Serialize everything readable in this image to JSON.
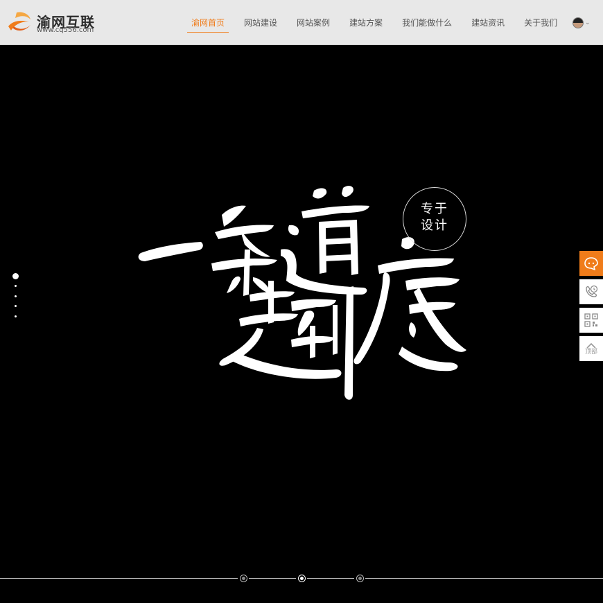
{
  "brand": {
    "title": "渝网互联",
    "url": "www.cq556.com"
  },
  "nav": {
    "items": [
      {
        "label": "渝网首页",
        "active": true
      },
      {
        "label": "网站建设",
        "active": false
      },
      {
        "label": "网站案例",
        "active": false
      },
      {
        "label": "建站方案",
        "active": false
      },
      {
        "label": "我们能做什么",
        "active": false
      },
      {
        "label": "建站资讯",
        "active": false
      },
      {
        "label": "关于我们",
        "active": false
      }
    ]
  },
  "hero": {
    "seal_line1": "专于",
    "seal_line2": "设计",
    "vertical_dots": 5,
    "active_vertical_dot": 0,
    "slider_dots": 3,
    "active_slider_dot": 1
  },
  "side": {
    "top_label": "顶部"
  },
  "colors": {
    "accent": "#f07c1a",
    "header_bg": "#e8e8e8",
    "hero_bg": "#000000"
  }
}
